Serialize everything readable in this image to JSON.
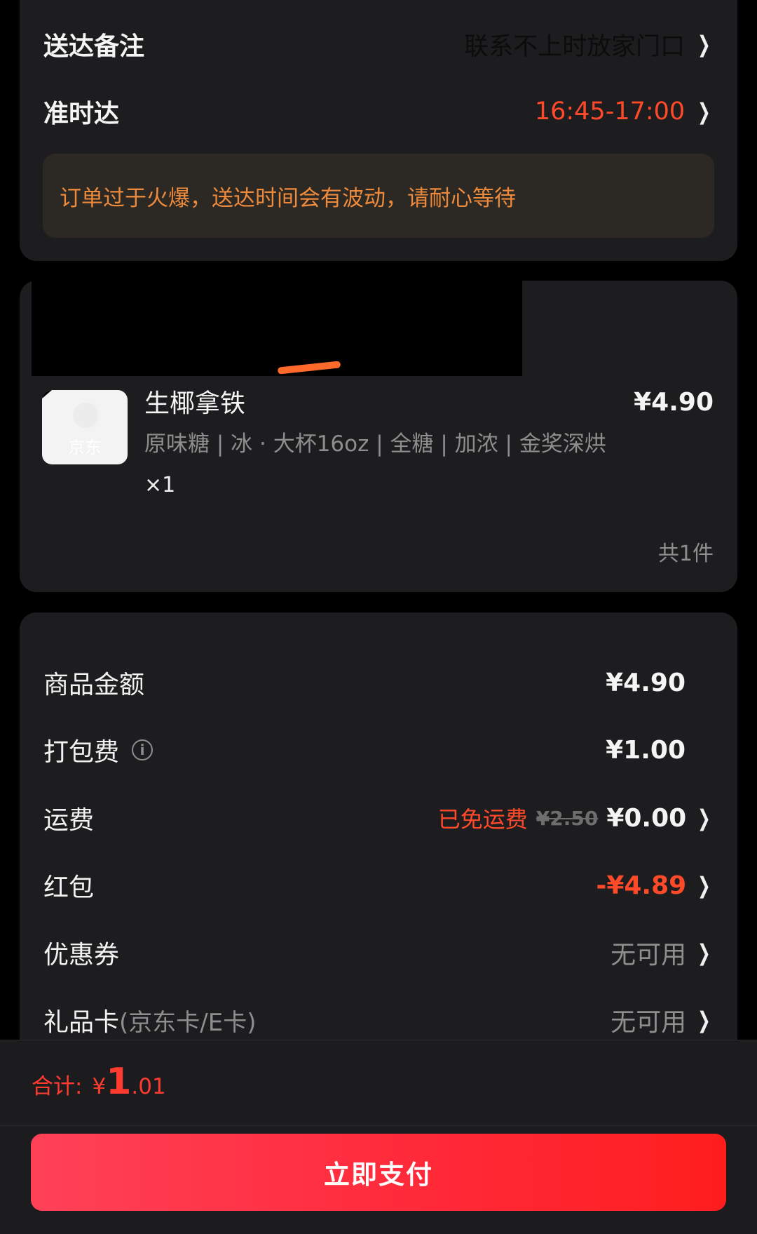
{
  "delivery": {
    "note_label": "送达备注",
    "note_value": "联系不上时放家门口",
    "ontime_label": "准时达",
    "ontime_value": "16:45-17:00",
    "notice": "订单过于火爆，送达时间会有波动，请耐心等待"
  },
  "product": {
    "thumb_watermark": "京东",
    "name": "生椰拿铁",
    "price": "¥4.90",
    "spec": "原味糖 | 冰 · 大杯16oz | 全糖 | 加浓 | 金奖深烘",
    "qty": "×1",
    "total_count": "共1件"
  },
  "fees": {
    "goods_label": "商品金额",
    "goods_value": "¥4.90",
    "pack_label": "打包费",
    "pack_value": "¥1.00",
    "delivery_label": "运费",
    "delivery_free_tag": "已免运费",
    "delivery_original": "¥2.50",
    "delivery_value": "¥0.00",
    "redpacket_label": "红包",
    "redpacket_value": "-¥4.89",
    "coupon_label": "优惠券",
    "coupon_value": "无可用",
    "giftcard_label": "礼品卡",
    "giftcard_sub": "(京东卡/E卡)",
    "giftcard_value": "无可用"
  },
  "bottom": {
    "total_label": "合计:",
    "currency": "¥",
    "total_int": "1",
    "total_dec": ".01",
    "pay_button": "立即支付"
  },
  "icons": {
    "chevron": "chevron-right-icon",
    "info": "info-icon"
  },
  "colors": {
    "accent_red": "#ff4a2a",
    "pay_gradient_start": "#ff4158",
    "pay_gradient_end": "#ff1e1e",
    "notice_text": "#ee8a3c"
  }
}
